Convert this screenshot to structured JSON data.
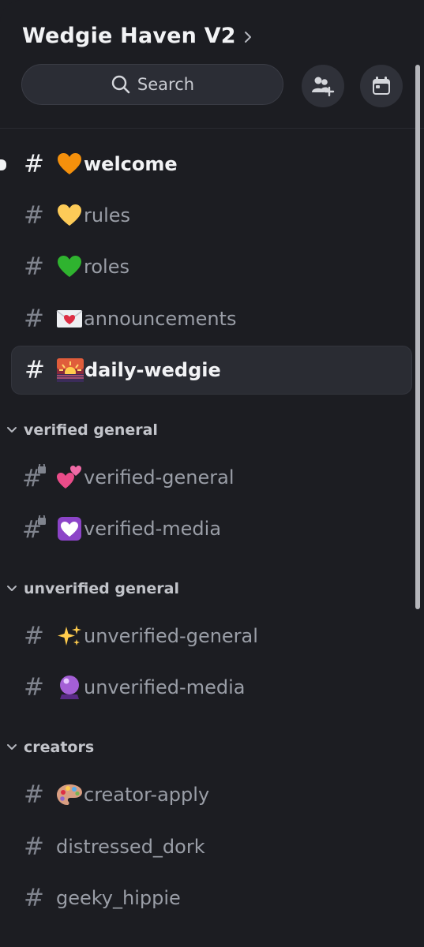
{
  "server": {
    "name": "Wedgie Haven V2"
  },
  "search": {
    "label": "Search"
  },
  "header_buttons": [
    {
      "icon": "invite-members-icon"
    },
    {
      "icon": "calendar-events-icon"
    }
  ],
  "channels": [
    {
      "name": "welcome",
      "emoji": "orange-heart",
      "state": "unread"
    },
    {
      "name": "rules",
      "emoji": "yellow-heart",
      "state": "read"
    },
    {
      "name": "roles",
      "emoji": "green-heart",
      "state": "read"
    },
    {
      "name": "announcements",
      "emoji": "love-letter",
      "state": "read"
    },
    {
      "name": "daily-wedgie",
      "emoji": "sunrise",
      "state": "selected"
    }
  ],
  "categories": [
    {
      "label": "verified general",
      "channels": [
        {
          "name": "verified-general",
          "emoji": "two-hearts",
          "locked": true
        },
        {
          "name": "verified-media",
          "emoji": "heart-decoration",
          "locked": true
        }
      ]
    },
    {
      "label": "unverified general",
      "channels": [
        {
          "name": "unverified-general",
          "emoji": "sparkles",
          "locked": false
        },
        {
          "name": "unverified-media",
          "emoji": "crystal-ball",
          "locked": false
        }
      ]
    },
    {
      "label": "creators",
      "channels": [
        {
          "name": "creator-apply",
          "emoji": "artist-palette",
          "locked": false
        },
        {
          "name": "distressed_dork",
          "emoji": "",
          "locked": false
        },
        {
          "name": "geeky_hippie",
          "emoji": "",
          "locked": false
        }
      ]
    }
  ],
  "colors": {
    "background": "#1c1d22",
    "text_active": "#f2f3f5",
    "text_muted": "#9a9ea7",
    "selected_bg": "#2a2c33"
  }
}
